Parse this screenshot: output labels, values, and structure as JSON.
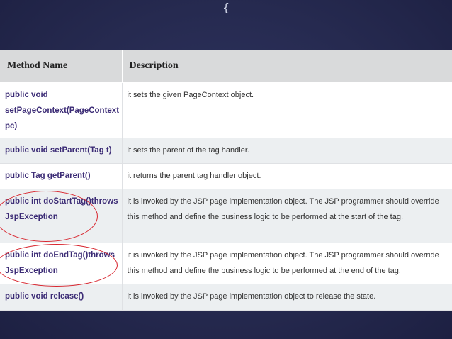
{
  "table": {
    "headers": [
      "Method Name",
      "Description"
    ],
    "rows": [
      {
        "method": "public void setPageContext(PageContext pc)",
        "description": "it sets the given PageContext object."
      },
      {
        "method": "public void setParent(Tag t)",
        "description": "it sets the parent of the tag handler."
      },
      {
        "method": "public Tag getParent()",
        "description": "it returns the parent tag handler object."
      },
      {
        "method": "public int doStartTag()throws JspException",
        "description": "it is invoked by the JSP page implementation object. The JSP programmer should override this method and define the business logic to be performed at the start of the tag."
      },
      {
        "method": "public int doEndTag()throws JspException",
        "description": "it is invoked by the JSP page implementation object. The JSP programmer should override this method and define the business logic to be performed at the end of the tag."
      },
      {
        "method": "public void release()",
        "description": "it is invoked by the JSP page implementation object to release the state."
      }
    ]
  },
  "colors": {
    "highlight": "#d8252e",
    "method_text": "#3b2b75",
    "background": "#262a50"
  },
  "icons": {
    "corner": "brace-icon"
  }
}
